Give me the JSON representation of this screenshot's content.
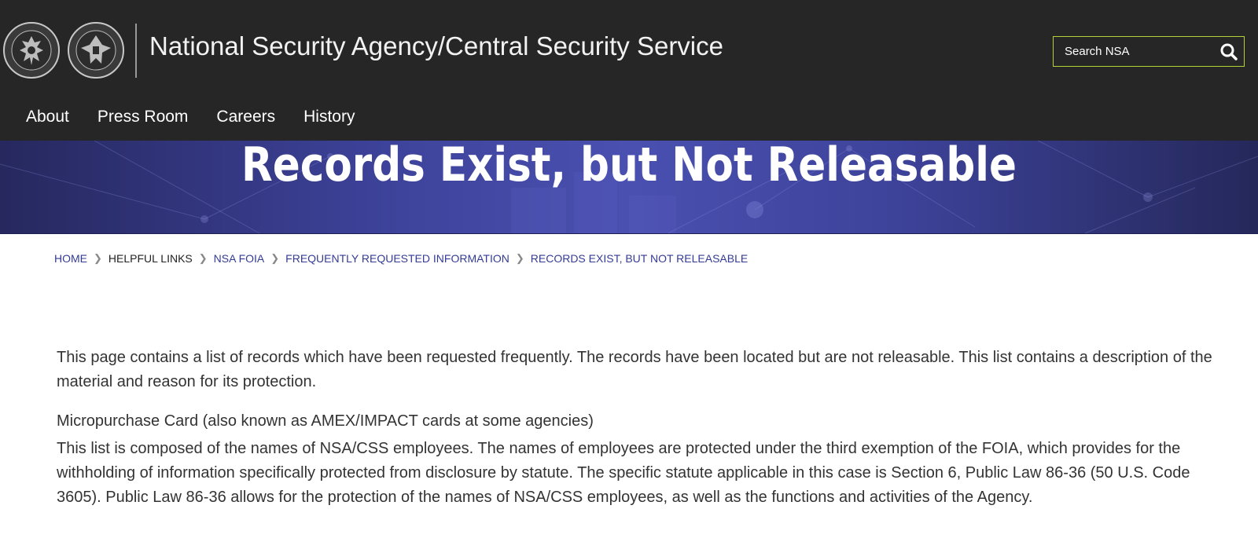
{
  "header": {
    "site_title": "National Security Agency/Central Security Service",
    "seal_nsa_text": "NATIONAL SECURITY AGENCY · UNITED STATES OF AMERICA",
    "seal_css_text": "CENTRAL SECURITY SERVICE · UNITED STATES OF AMERICA",
    "search_placeholder": "Search NSA",
    "search_border_color": "#b3d234",
    "nav": [
      {
        "label": "About"
      },
      {
        "label": "Press Room"
      },
      {
        "label": "Careers"
      },
      {
        "label": "History"
      }
    ]
  },
  "hero": {
    "title": "Records Exist, but Not Releasable"
  },
  "breadcrumb": [
    {
      "label": "HOME"
    },
    {
      "label": "HELPFUL LINKS"
    },
    {
      "label": "NSA FOIA"
    },
    {
      "label": "FREQUENTLY REQUESTED INFORMATION"
    },
    {
      "label": "RECORDS EXIST, BUT NOT RELEASABLE"
    }
  ],
  "content": {
    "intro": "This page contains a list of records which have been requested frequently. The records have been located but are not releasable. This list contains a description of the material and reason for its protection.",
    "section_title": "Micropurchase Card (also known as AMEX/IMPACT cards at some agencies)",
    "section_body": "This list is composed of the names of NSA/CSS employees. The names of employees are protected under the third exemption of the FOIA, which provides for the withholding of information specifically protected from disclosure by statute. The specific statute applicable in this case is Section 6, Public Law 86-36 (50 U.S. Code 3605). Public Law 86-36 allows for the protection of the names of NSA/CSS employees, as well as the functions and activities of the Agency."
  }
}
